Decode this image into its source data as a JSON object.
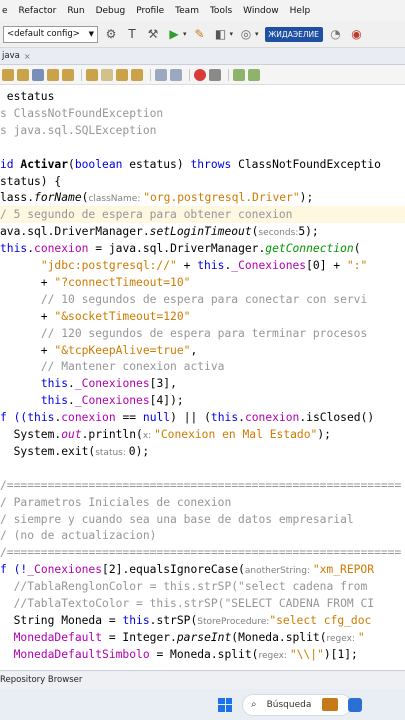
{
  "menu": [
    "e",
    "Refactor",
    "Run",
    "Debug",
    "Profile",
    "Team",
    "Tools",
    "Window",
    "Help"
  ],
  "toolbar": {
    "config_value": "<default config>",
    "search_text": "ЖИДАЭЕЛИЕ"
  },
  "file_tab": {
    "label": "java",
    "close": "×"
  },
  "code_lines": [
    {
      "text": " estatus"
    },
    {
      "text": "s ClassNotFoundException",
      "cls": "cmt"
    },
    {
      "text": "s java.sql.SQLException",
      "cls": "cmt"
    },
    {
      "text": ""
    },
    {
      "segments": [
        [
          "id ",
          "kw"
        ],
        [
          "Activar",
          "fn"
        ],
        [
          "(",
          ""
        ],
        [
          "boolean",
          "kw"
        ],
        [
          " estatus) ",
          ""
        ],
        [
          "throws",
          "kw"
        ],
        [
          " ClassNotFoundExceptio",
          ""
        ]
      ]
    },
    {
      "text": "status) {"
    },
    {
      "segments": [
        [
          "lass.",
          ""
        ],
        [
          "forName",
          "it"
        ],
        [
          "(",
          ""
        ],
        [
          "className: ",
          "hint"
        ],
        [
          "\"org.postgresql.Driver\"",
          "str"
        ],
        [
          ");",
          ""
        ]
      ]
    },
    {
      "text": "/ 5 segundo de espera para obtener conexion",
      "cls": "cmt",
      "hl": true
    },
    {
      "segments": [
        [
          "ava.sql.DriverManager.",
          ""
        ],
        [
          "setLoginTimeout",
          "it"
        ],
        [
          "(",
          ""
        ],
        [
          "seconds:",
          "hint"
        ],
        [
          "5);",
          ""
        ]
      ]
    },
    {
      "segments": [
        [
          "this",
          "kw"
        ],
        [
          ".",
          ""
        ],
        [
          "conexion",
          "purple"
        ],
        [
          " = java.sql.DriverManager.",
          ""
        ],
        [
          "getConnection",
          "it fld"
        ],
        [
          "(",
          ""
        ]
      ]
    },
    {
      "segments": [
        [
          "      ",
          ""
        ],
        [
          "\"jdbc:postgresql://\"",
          "str"
        ],
        [
          " + ",
          ""
        ],
        [
          "this",
          "kw"
        ],
        [
          ".",
          ""
        ],
        [
          "_Conexiones",
          "purple"
        ],
        [
          "[0] + ",
          ""
        ],
        [
          "\":\"",
          "str"
        ]
      ]
    },
    {
      "segments": [
        [
          "      + ",
          ""
        ],
        [
          "\"?connectTimeout=10\"",
          "str"
        ]
      ]
    },
    {
      "segments": [
        [
          "      ",
          ""
        ],
        [
          "// 10 segundos de espera para conectar con servi",
          "cmt"
        ]
      ]
    },
    {
      "segments": [
        [
          "      + ",
          ""
        ],
        [
          "\"&socketTimeout=120\"",
          "str"
        ]
      ]
    },
    {
      "segments": [
        [
          "      ",
          ""
        ],
        [
          "// 120 segundos de espera para terminar procesos",
          "cmt"
        ]
      ]
    },
    {
      "segments": [
        [
          "      + ",
          ""
        ],
        [
          "\"&tcpKeepAlive=true\"",
          "str"
        ],
        [
          ",",
          ""
        ]
      ]
    },
    {
      "segments": [
        [
          "      ",
          ""
        ],
        [
          "// Mantener conexion activa",
          "cmt"
        ]
      ]
    },
    {
      "segments": [
        [
          "      ",
          ""
        ],
        [
          "this",
          "kw"
        ],
        [
          ".",
          ""
        ],
        [
          "_Conexiones",
          "purple"
        ],
        [
          "[3],",
          ""
        ]
      ]
    },
    {
      "segments": [
        [
          "      ",
          ""
        ],
        [
          "this",
          "kw"
        ],
        [
          ".",
          ""
        ],
        [
          "_Conexiones",
          "purple"
        ],
        [
          "[4]);",
          ""
        ]
      ]
    },
    {
      "segments": [
        [
          "f ((",
          "kw"
        ],
        [
          "this",
          "kw"
        ],
        [
          ".",
          ""
        ],
        [
          "conexion",
          "purple"
        ],
        [
          " == ",
          ""
        ],
        [
          "null",
          "kw"
        ],
        [
          ") || (",
          ""
        ],
        [
          "this",
          "kw"
        ],
        [
          ".",
          ""
        ],
        [
          "conexion",
          "purple"
        ],
        [
          ".isClosed()",
          ""
        ]
      ]
    },
    {
      "segments": [
        [
          "  System.",
          ""
        ],
        [
          "out",
          "it purple"
        ],
        [
          ".println(",
          ""
        ],
        [
          "x: ",
          "hint"
        ],
        [
          "\"Conexion en Mal Estado\"",
          "str"
        ],
        [
          ");",
          ""
        ]
      ]
    },
    {
      "segments": [
        [
          "  System.exit(",
          ""
        ],
        [
          "status: ",
          "hint"
        ],
        [
          "0);",
          ""
        ]
      ]
    },
    {
      "text": ""
    },
    {
      "text": "/==========================================================",
      "cls": "cmt"
    },
    {
      "text": "/ Parametros Iniciales de conexion",
      "cls": "cmt"
    },
    {
      "text": "/ siempre y cuando sea una base de datos empresarial",
      "cls": "cmt"
    },
    {
      "text": "/ (no de actualizacion)",
      "cls": "cmt"
    },
    {
      "text": "/==========================================================",
      "cls": "cmt"
    },
    {
      "segments": [
        [
          "f (!",
          "kw"
        ],
        [
          "_Conexiones",
          "purple"
        ],
        [
          "[2].equalsIgnoreCase(",
          ""
        ],
        [
          "anotherString: ",
          "hint"
        ],
        [
          "\"xm_REPOR",
          "str"
        ]
      ]
    },
    {
      "text": "  //TablaRenglonColor = this.strSP(\"select cadena from",
      "cls": "cmt"
    },
    {
      "text": "  //TablaTextoColor = this.strSP(\"SELECT CADENA FROM CI",
      "cls": "cmt"
    },
    {
      "segments": [
        [
          "  String Moneda = ",
          ""
        ],
        [
          "this",
          "kw"
        ],
        [
          ".strSP(",
          ""
        ],
        [
          "StoreProcedure:",
          "hint"
        ],
        [
          "\"select cfg_doc",
          "str"
        ]
      ]
    },
    {
      "segments": [
        [
          "  ",
          ""
        ],
        [
          "MonedaDefault",
          "purple"
        ],
        [
          " = Integer.",
          ""
        ],
        [
          "parseInt",
          "it"
        ],
        [
          "(Moneda.split(",
          ""
        ],
        [
          "regex: ",
          "hint"
        ],
        [
          "\"",
          "str"
        ]
      ]
    },
    {
      "segments": [
        [
          "  ",
          ""
        ],
        [
          "MonedaDefaultSimbolo",
          "purple"
        ],
        [
          " = Moneda.split(",
          ""
        ],
        [
          "regex: ",
          "hint"
        ],
        [
          "\"\\\\|\"",
          "str"
        ],
        [
          ")[1];",
          ""
        ]
      ]
    }
  ],
  "bottom_panel": {
    "label": "Repository Browser"
  },
  "taskbar": {
    "search_placeholder": "Búsqueda"
  }
}
